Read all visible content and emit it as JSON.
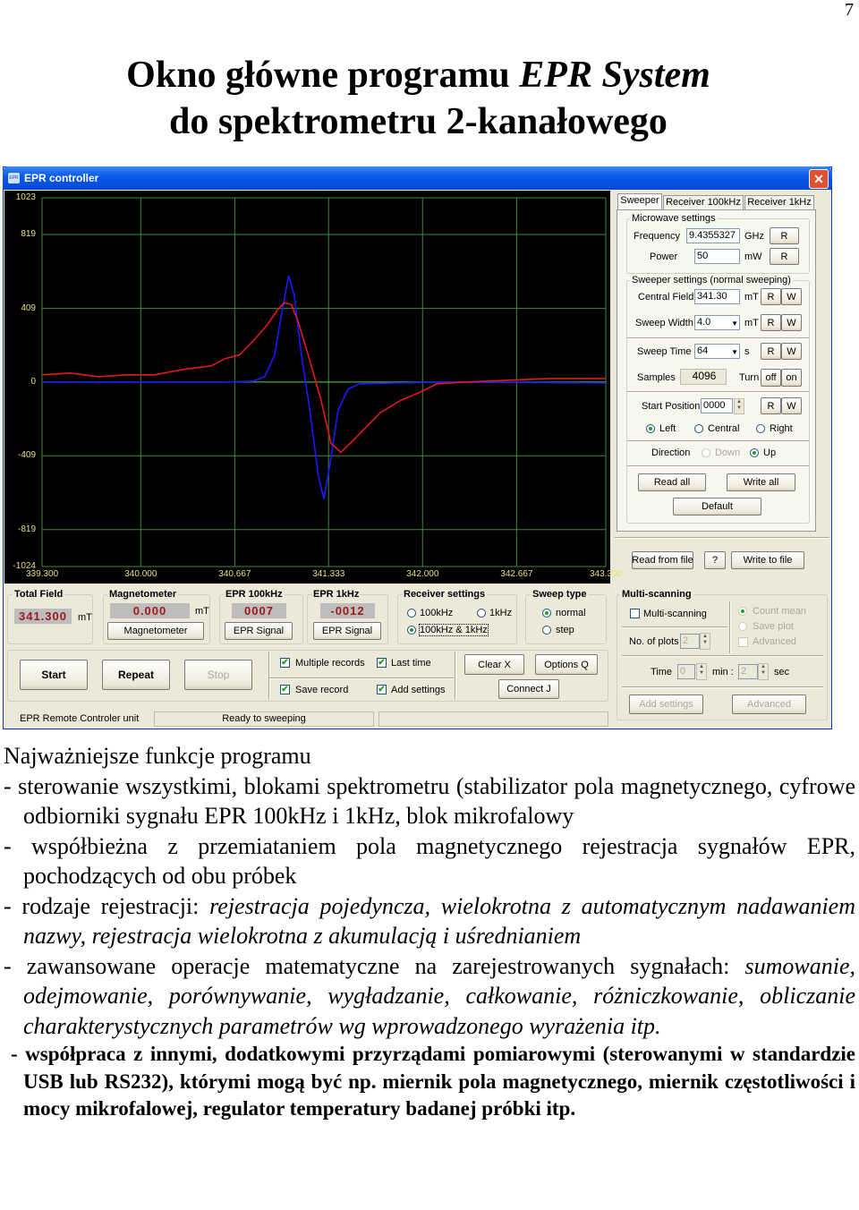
{
  "page_number": "7",
  "doc_title": {
    "line1_pre": "Okno główne programu ",
    "line1_em": "EPR System",
    "line2": "do spektrometru 2-kanałowego"
  },
  "window": {
    "title": "EPR controller",
    "icon_text": "EPR",
    "tabs": [
      "Sweeper",
      "Receiver 100kHz",
      "Receiver 1kHz"
    ],
    "active_tab": "Sweeper",
    "microwave": {
      "label": "Microwave settings",
      "frequency_label": "Frequency",
      "frequency": "9.4355327",
      "frequency_unit": "GHz",
      "power_label": "Power",
      "power": "50",
      "power_unit": "mW",
      "r": "R"
    },
    "sweeper": {
      "label": "Sweeper settings (normal sweeping)",
      "central_field_label": "Central Field",
      "central_field": "341.30",
      "unit_mt": "mT",
      "sweep_width_label": "Sweep Width",
      "sweep_width": "4.0",
      "sweep_time_label": "Sweep Time",
      "sweep_time": "64",
      "unit_s": "s",
      "samples_label": "Samples",
      "samples": "4096",
      "turn_label": "Turn",
      "off": "off",
      "on": "on",
      "start_position_label": "Start Position",
      "start_position": "0000",
      "r": "R",
      "w": "W",
      "left": "Left",
      "central": "Central",
      "right": "Right",
      "position_selected": "Left",
      "direction_label": "Direction",
      "down": "Down",
      "up": "Up",
      "direction_selected": "Up",
      "read_all": "Read all",
      "write_all": "Write all",
      "default": "Default"
    },
    "file": {
      "read": "Read from file",
      "help": "?",
      "write": "Write to file"
    },
    "total_field": {
      "label": "Total Field",
      "value": "341.300",
      "unit": "mT"
    },
    "magnetometer": {
      "label": "Magnetometer",
      "value": "0.000",
      "unit": "mT",
      "button": "Magnetometer"
    },
    "epr100": {
      "label": "EPR 100kHz",
      "value": "0007",
      "button": "EPR Signal"
    },
    "epr1": {
      "label": "EPR 1kHz",
      "value": "-0012",
      "button": "EPR Signal"
    },
    "receiver_settings": {
      "label": "Receiver settings",
      "opt1": "100kHz",
      "opt2": "1kHz",
      "opt3": "100kHz & 1kHz",
      "selected": "100kHz & 1kHz"
    },
    "sweep_type": {
      "label": "Sweep type",
      "opt1": "normal",
      "opt2": "step",
      "selected": "normal"
    },
    "actions": {
      "start": "Start",
      "repeat": "Repeat",
      "stop": "Stop",
      "clear": "Clear X",
      "options": "Options Q",
      "connect": "Connect J"
    },
    "checks": {
      "multiple_records": "Multiple records",
      "last_time": "Last time",
      "save_record": "Save record",
      "add_settings": "Add settings",
      "all_checked": true
    },
    "multi": {
      "label": "Multi-scanning",
      "check": "Multi-scanning",
      "checked": false,
      "plots_label": "No. of plots",
      "plots": "2",
      "count_mean": "Count mean",
      "save_plot": "Save plot",
      "advanced_check": "Advanced",
      "time_label": "Time",
      "min_value": "0",
      "min_label": "min :",
      "sec_value": "2",
      "sec_label": "sec",
      "add_settings": "Add settings",
      "advanced": "Advanced"
    },
    "status": {
      "left": "EPR Remote Controler unit",
      "middle": "Ready to sweeping",
      "right": ""
    }
  },
  "chart_data": {
    "type": "line",
    "xlim": [
      339.3,
      343.3
    ],
    "ylim": [
      -1024,
      1023
    ],
    "x_ticks": [
      "339.300",
      "340.000",
      "340.667",
      "341.333",
      "342.000",
      "342.667",
      "343.300"
    ],
    "y_ticks": [
      "1023",
      "819",
      "409",
      "0",
      "-409",
      "-819",
      "-1024"
    ],
    "grid": true,
    "background": "#000000",
    "grid_color": "#3c8c3c",
    "series": [
      {
        "color": "#1a1aff",
        "points": [
          [
            339.3,
            0
          ],
          [
            340.0,
            0
          ],
          [
            340.6,
            0
          ],
          [
            340.8,
            5
          ],
          [
            340.88,
            30
          ],
          [
            340.95,
            150
          ],
          [
            341.0,
            380
          ],
          [
            341.05,
            590
          ],
          [
            341.09,
            480
          ],
          [
            341.14,
            150
          ],
          [
            341.2,
            -150
          ],
          [
            341.26,
            -520
          ],
          [
            341.3,
            -650
          ],
          [
            341.35,
            -420
          ],
          [
            341.4,
            -160
          ],
          [
            341.47,
            -40
          ],
          [
            341.55,
            -10
          ],
          [
            341.8,
            -5
          ],
          [
            342.2,
            0
          ],
          [
            343.3,
            -5
          ]
        ]
      },
      {
        "color": "#e01b1b",
        "points": [
          [
            339.3,
            40
          ],
          [
            339.5,
            50
          ],
          [
            339.7,
            30
          ],
          [
            339.9,
            40
          ],
          [
            340.1,
            40
          ],
          [
            340.3,
            70
          ],
          [
            340.5,
            90
          ],
          [
            340.6,
            130
          ],
          [
            340.7,
            150
          ],
          [
            340.8,
            230
          ],
          [
            340.9,
            320
          ],
          [
            340.97,
            400
          ],
          [
            341.02,
            440
          ],
          [
            341.07,
            430
          ],
          [
            341.12,
            330
          ],
          [
            341.2,
            120
          ],
          [
            341.28,
            -100
          ],
          [
            341.35,
            -340
          ],
          [
            341.42,
            -390
          ],
          [
            341.5,
            -330
          ],
          [
            341.6,
            -250
          ],
          [
            341.7,
            -170
          ],
          [
            341.85,
            -100
          ],
          [
            342.0,
            -50
          ],
          [
            342.1,
            -10
          ],
          [
            342.3,
            0
          ],
          [
            342.6,
            10
          ],
          [
            342.9,
            20
          ],
          [
            343.3,
            20
          ]
        ]
      }
    ]
  },
  "doc_body": {
    "heading": "Najważniejsze funkcje programu",
    "bullets": [
      [
        {
          "t": "- sterowanie wszystkimi, blokami spektrometru (stabilizator pola magnetycznego, cyfrowe odbiorniki sygnału EPR 100kHz i 1kHz, blok mikrofalowy"
        }
      ],
      [
        {
          "t": "- współbieżna z przemiataniem pola magnetycznego rejestracja sygnałów EPR, pochodzących od obu próbek"
        }
      ],
      [
        {
          "t": "- rodzaje rejestracji: "
        },
        {
          "t": "rejestracja pojedyncza, wielokrotna z automatycznym nadawaniem nazwy, rejestracja wielokrotna z akumulacją i uśrednianiem",
          "i": true
        }
      ],
      [
        {
          "t": "- zawansowane operacje matematyczne na zarejestrowanych sygnałach: "
        },
        {
          "t": "sumowanie, odejmowanie, porównywanie, wygładzanie, całkowanie, różniczkowanie, obliczanie charakterystycznych parametrów wg wprowadzonego wyrażenia itp.",
          "i": true
        }
      ]
    ],
    "last": "- współpraca z innymi, dodatkowymi przyrządami pomiarowymi (sterowanymi w standardzie USB lub RS232), którymi mogą być np. miernik pola magnetycznego, miernik częstotliwości i mocy mikrofalowej, regulator temperatury badanej próbki itp."
  }
}
